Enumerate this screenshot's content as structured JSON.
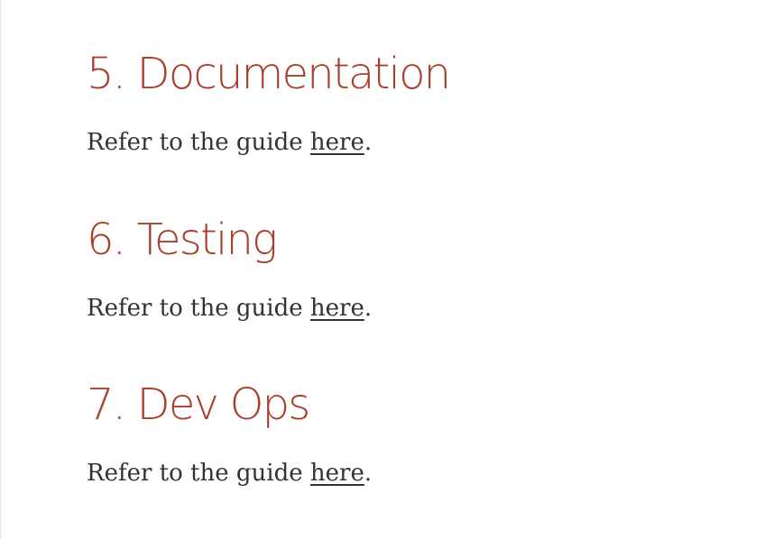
{
  "sections": [
    {
      "heading": "5. Documentation",
      "text_before": "Refer to the guide ",
      "link_label": "here",
      "text_after": "."
    },
    {
      "heading": "6. Testing",
      "text_before": "Refer to the guide ",
      "link_label": "here",
      "text_after": "."
    },
    {
      "heading": "7. Dev Ops",
      "text_before": "Refer to the guide ",
      "link_label": "here",
      "text_after": "."
    }
  ],
  "colors": {
    "heading": "#a84030",
    "body_text": "#333333",
    "background": "#ffffff"
  }
}
